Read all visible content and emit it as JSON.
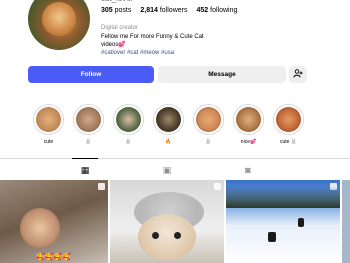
{
  "profile": {
    "username": "cat_lover",
    "stats": {
      "posts_count": "305",
      "posts_label": "posts",
      "followers_count": "2,814",
      "followers_label": "followers",
      "following_count": "452",
      "following_label": "following"
    },
    "bio": {
      "category": "Digital creator",
      "line1": "Fellow me For more Funny & Cute Cat",
      "line2": "videos💕",
      "hashtags": "#catlover #cat #meow #usa"
    }
  },
  "actions": {
    "follow_label": "Follow",
    "message_label": "Message",
    "suggest_icon": "add-person-icon"
  },
  "highlights": [
    {
      "label": "cute",
      "color": "#c08a5a"
    },
    {
      "label": "🐰",
      "color": "#a07a5a"
    },
    {
      "label": "🐰",
      "color": "#5a6a4a"
    },
    {
      "label": "🔥",
      "color": "#4a3a2a"
    },
    {
      "label": "🐰",
      "color": "#d08a5a"
    },
    {
      "label": "nice💕",
      "color": "#b07a4a"
    },
    {
      "label": "cute 🐰",
      "color": "#c06a3a"
    }
  ],
  "tabs": [
    {
      "name": "posts",
      "icon": "grid-icon",
      "glyph": "▦"
    },
    {
      "name": "reels",
      "icon": "reels-icon",
      "glyph": "▣"
    },
    {
      "name": "tagged",
      "icon": "tagged-icon",
      "glyph": "◙"
    }
  ],
  "grid": {
    "post1_overlay": "🥰🥰🥰🥰"
  },
  "colors": {
    "accent": "#4a5cf5",
    "button_gray": "#efefef",
    "link": "#385185"
  }
}
